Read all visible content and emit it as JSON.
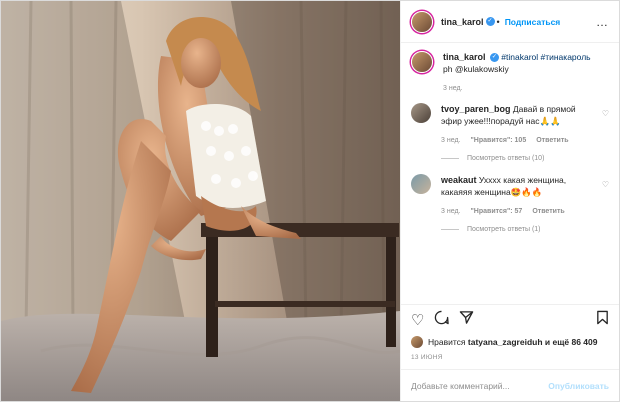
{
  "header": {
    "username": "tina_karol",
    "verified_icon": "check",
    "separator": "•",
    "follow_label": "Подписаться",
    "more_icon": "…"
  },
  "caption": {
    "username": "tina_karol",
    "hashtags": "#tinakarol #тинакароль",
    "text": "ph @kulakowskiy",
    "time": "3 нед."
  },
  "comments": [
    {
      "username": "tvoy_paren_bog",
      "text": "Давай в прямой эфир ужее!!!порадуй нас🙏🙏",
      "time": "3 нед.",
      "likes": "\"Нравится\": 105",
      "reply": "Ответить",
      "view_replies": "Посмотреть ответы (10)"
    },
    {
      "username": "weakaut",
      "text": "Ухххх какая женщина, какаяяя женщина🤩🔥🔥",
      "time": "3 нед.",
      "likes": "\"Нравится\": 57",
      "reply": "Ответить",
      "view_replies": "Посмотреть ответы (1)"
    }
  ],
  "likes": {
    "prefix": "Нравится",
    "user": "tatyana_zagreiduh",
    "suffix": "и ещё 86 409"
  },
  "date": "13 ИЮНЯ",
  "add_comment": {
    "placeholder": "Добавьте комментарий...",
    "publish_label": "Опубликовать"
  }
}
